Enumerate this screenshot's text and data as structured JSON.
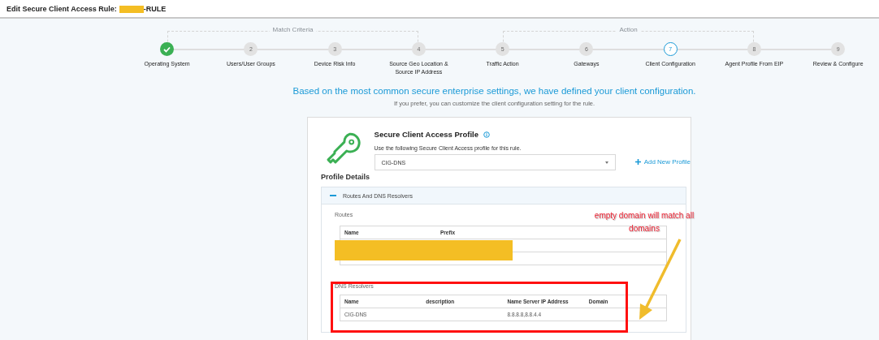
{
  "header": {
    "title": "Edit Secure Client Access Rule:",
    "title_redacted": true,
    "title_suffix": "-RULE"
  },
  "stepper": {
    "sections": [
      {
        "label": "Match Criteria",
        "steps": [
          {
            "label": "Operating System",
            "completed": true,
            "selected": false
          },
          {
            "number": "2",
            "label": "Users/User Groups",
            "completed": false,
            "selected": false
          },
          {
            "number": "3",
            "label": "Device Risk Info",
            "completed": false,
            "selected": false
          },
          {
            "number": "4",
            "label": "Source Geo Location & Source IP Address",
            "completed": false,
            "selected": false
          }
        ]
      },
      {
        "label": "Action",
        "steps": [
          {
            "number": "5",
            "label": "Traffic Action",
            "completed": false,
            "selected": false
          },
          {
            "number": "6",
            "label": "Gateways",
            "completed": false,
            "selected": false
          },
          {
            "number": "7",
            "label": "Client Configuration",
            "completed": false,
            "selected": true
          },
          {
            "number": "8",
            "label": "Agent Profile From EIP",
            "completed": false,
            "selected": false
          }
        ]
      },
      {
        "steps": [
          {
            "number": "9",
            "label": "Review & Configure",
            "completed": false,
            "selected": false
          }
        ]
      }
    ]
  },
  "intro": {
    "heading": "Based on the most common secure enterprise settings, we have defined your client configuration.",
    "subtext": "If you prefer, you can customize the client configuration setting for the rule."
  },
  "profile": {
    "title": "Secure Client Access Profile",
    "description": "Use the following Secure Client Access profile for this rule.",
    "selected_profile": "CIG-DNS",
    "add_button": "Add New Profile"
  },
  "profile_details": {
    "title": "Profile Details",
    "section": {
      "title": "Routes And DNS Resolvers",
      "expanded": true
    },
    "routes": {
      "label": "Routes",
      "columns": [
        "Name",
        "Prefix"
      ],
      "redacted": true
    },
    "dns_resolvers": {
      "label": "DNS Resolvers",
      "columns": [
        "Name",
        "description",
        "Name Server IP Address",
        "Domain"
      ],
      "rows": [
        [
          "CIG-DNS",
          "",
          "8.8.8.8,8.8.4.4",
          ""
        ]
      ]
    }
  },
  "annotation": {
    "note": "empty domain will match all domains"
  }
}
